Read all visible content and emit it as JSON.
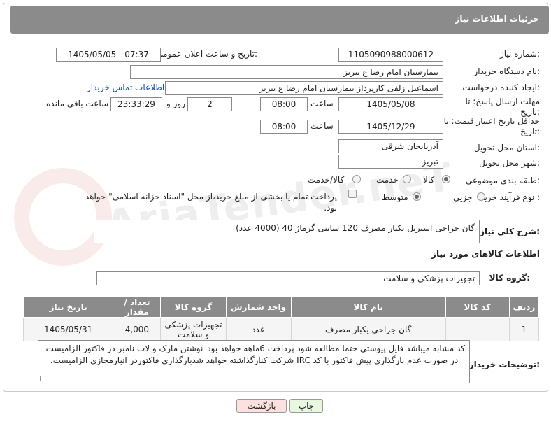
{
  "header": {
    "title": "جزئیات اطلاعات نیاز"
  },
  "form": {
    "need_number_label": "شماره نیاز:",
    "need_number": "1105090988000612",
    "announce_label": "تاریخ و ساعت اعلان عمومی:",
    "announce_value": "1405/05/05 - 07:37",
    "buyer_org_label": "نام دستگاه خریدار:",
    "buyer_org": "بیمارستان امام رضا  ع  تبریز",
    "creator_label": "ایجاد کننده درخواست:",
    "creator": "اسماعیل زلفی کارپرداز بیمارستان امام رضا  ع  تبریز",
    "contact_link": "اطلاعات تماس خریدار",
    "deadline_label": "مهلت ارسال پاسخ: تا تاریخ:",
    "deadline_date": "1405/05/08",
    "hour_label": "ساعت",
    "deadline_time": "08:00",
    "days_value": "2",
    "days_label": "روز و",
    "remaining_time": "23:33:29",
    "remaining_label": "ساعت باقی مانده",
    "price_validity_label": "حداقل تاریخ اعتبار قیمت: تا تاریخ:",
    "price_validity_date": "1405/12/29",
    "price_validity_time": "08:00",
    "province_label": "استان محل تحویل:",
    "province": "آذربایجان شرقی",
    "city_label": "شهر محل تحویل:",
    "city": "تبریز",
    "category_label": "طبقه بندی موضوعی:",
    "category_options": [
      "کالا",
      "خدمت",
      "کالا/خدمت"
    ],
    "purchase_type_label": "نوع فرآیند خرید :",
    "purchase_options": [
      "جزیی",
      "متوسط"
    ],
    "payment_note": "پرداخت تمام یا بخشی از مبلغ خرید،از محل \"اسناد خزانه اسلامی\" خواهد بود."
  },
  "description": {
    "label": "شرح کلی نیاز:",
    "value": "گان جراحی استریل یکبار مصرف 120 سانتی گرماژ 40 (4000 عدد)"
  },
  "goods_info": {
    "title": "اطلاعات کالاهای مورد نیاز",
    "group_label": "گروه کالا:",
    "group_value": "تجهیزات پزشکی و سلامت"
  },
  "table": {
    "headers": [
      "ردیف",
      "کد کالا",
      "نام کالا",
      "واحد شمارش",
      "گروه کالا",
      "تعداد / مقدار",
      "تاریخ نیاز"
    ],
    "rows": [
      [
        "1",
        "--",
        "گان جراحی یکبار مصرف",
        "عدد",
        "تجهیزات پزشکی و سلامت",
        "4,000",
        "1405/05/31"
      ]
    ]
  },
  "buyer_notes": {
    "label": "توضیحات خریدار:",
    "value": "کد مشابه میباشد فایل پیوستی حتما مطالعه شود  پرداخت 6ماهه خواهد بود_نوشتن مارک و لات نامبر در فاکتور الزامیست _ در صورت عدم بارگذاری پیش فاکتور با کد IRC  شرکت کنارگذاشته خواهد شدبارگذاری فاکتوردر انبارمجازی الزامیست."
  },
  "buttons": {
    "print": "چاپ",
    "back": "بازگشت"
  },
  "watermark": "AriaTender.neT",
  "colors": {
    "header_bg": "#8b8b8b",
    "link": "#1a4fa3",
    "print_btn": "#e8f7df",
    "back_btn": "#fde0e0"
  }
}
